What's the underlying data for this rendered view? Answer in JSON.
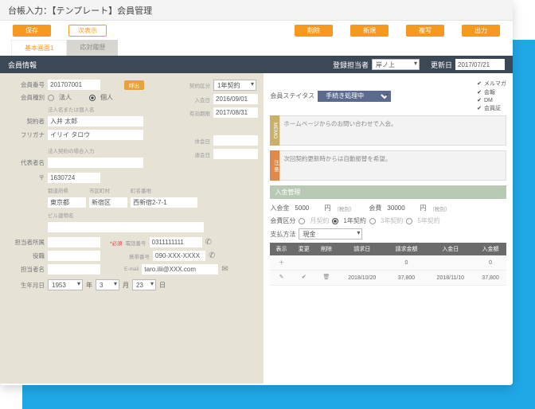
{
  "title": "台帳入力：【テンプレート】会員管理",
  "toolbar": {
    "save": "保存",
    "next": "次表示",
    "del": "削除",
    "new": "新規",
    "dup": "複写",
    "out": "出力"
  },
  "tabs": {
    "t1": "基本画面1",
    "t2": "応対履歴"
  },
  "header": {
    "title": "会員情報",
    "rep_lbl": "登録担当者",
    "rep_val": "岸ノ上",
    "upd_lbl": "更新日",
    "upd_val": "2017/07/21"
  },
  "checks": {
    "c1": "メルマガ",
    "c2": "会報",
    "c3": "DM",
    "c4": "会員証"
  },
  "left": {
    "memno_lbl": "会員番号",
    "memno": "201707001",
    "call": "呼出",
    "type_lbl": "会員種別",
    "corp": "法人",
    "ind": "個人",
    "name_hint": "法人名または個人名",
    "contractor_lbl": "契約者",
    "contractor": "入井 太郎",
    "kana_lbl": "フリガナ",
    "kana": "イリイ タロウ",
    "corp_hint": "法人契約の場合入力",
    "rep_lbl": "代表者名",
    "zip_lbl": "〒",
    "zip": "1630724",
    "pref_h": "都道府県",
    "city_h": "市区町村",
    "town_h": "町名番地",
    "pref": "東京都",
    "city": "新宿区",
    "town": "西新宿2-7-1",
    "bldg_h": "ビル建物名",
    "dept_lbl": "担当者所属",
    "req": "*必須",
    "tel_lbl": "電話番号",
    "tel": "0311111111",
    "role_lbl": "役職",
    "mob_lbl": "携帯番号",
    "mob": "090-XXX-XXXX",
    "person_lbl": "担当者名",
    "mail_lbl": "E-mail",
    "mail": "taro.ilii@XXX.com",
    "birth_lbl": "生年月日",
    "by": "1953",
    "bm": "3",
    "bd": "23",
    "yl": "年",
    "ml": "月",
    "dl": "日"
  },
  "mid": {
    "ctype_lbl": "契約区分",
    "ctype": "1年契約",
    "join_lbl": "入会日",
    "join": "2016/09/01",
    "exp_lbl": "有効期限",
    "exp": "2017/08/31",
    "rest_lbl": "休会日",
    "leave_lbl": "退会日"
  },
  "right": {
    "status_lbl": "会員ステイタス",
    "status": "手続き処理中",
    "memo_tag": "MEMO",
    "memo": "ホームページからのお問い合わせで入会。",
    "note_tag": "注 意",
    "note": "次回契約更新時からは自動振替を希望。",
    "mgmt_hdr": "入金管理",
    "fee1_lbl": "入会金",
    "fee1": "5000",
    "yen": "円",
    "tax": "（税別）",
    "fee2_lbl": "会費",
    "fee2": "30000",
    "plan_lbl": "会費区分",
    "p_m": "月契約",
    "p_1": "1年契約",
    "p_3": "3年契約",
    "p_5": "5年契約",
    "pay_lbl": "支払方法",
    "pay": "現金",
    "th": {
      "show": "表示",
      "edit": "変更",
      "del": "削除",
      "bd": "請求日",
      "ba": "請求金額",
      "pd": "入金日",
      "pa": "入金額"
    },
    "rows": [
      {
        "bd": "",
        "ba": "0",
        "pd": "",
        "pa": "0"
      },
      {
        "bd": "2018/10/20",
        "ba": "37,800",
        "pd": "2018/11/10",
        "pa": "37,800"
      }
    ]
  }
}
